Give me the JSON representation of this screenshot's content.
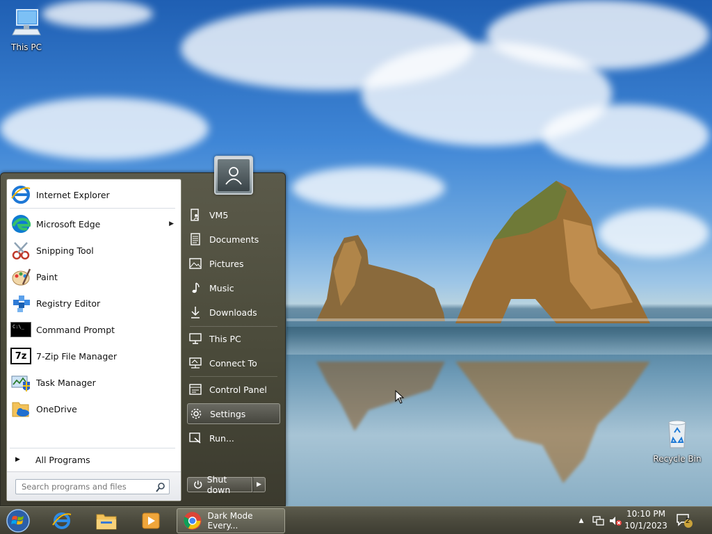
{
  "desktop": {
    "icons": [
      {
        "label": "This PC"
      },
      {
        "label": "Recycle Bin"
      }
    ]
  },
  "start_menu": {
    "programs": [
      {
        "label": "Internet Explorer",
        "icon": "internet-explorer-icon"
      },
      {
        "label": "Microsoft Edge",
        "icon": "edge-icon",
        "has_submenu": true
      },
      {
        "label": "Snipping Tool",
        "icon": "scissors-icon"
      },
      {
        "label": "Paint",
        "icon": "paint-palette-icon"
      },
      {
        "label": "Registry Editor",
        "icon": "registry-icon"
      },
      {
        "label": "Command Prompt",
        "icon": "cmd-icon"
      },
      {
        "label": "7-Zip File Manager",
        "icon": "7zip-icon"
      },
      {
        "label": "Task Manager",
        "icon": "task-manager-icon"
      },
      {
        "label": "OneDrive",
        "icon": "onedrive-icon"
      }
    ],
    "cmd_icon_text": "C:\\_",
    "sevenzip_icon_text": "7z",
    "all_programs_label": "All Programs",
    "search_placeholder": "Search programs and files",
    "places": [
      {
        "label": "VM5",
        "icon": "user-folder-icon"
      },
      {
        "label": "Documents",
        "icon": "document-icon"
      },
      {
        "label": "Pictures",
        "icon": "picture-icon"
      },
      {
        "label": "Music",
        "icon": "music-note-icon"
      },
      {
        "label": "Downloads",
        "icon": "download-arrow-icon"
      },
      {
        "label": "This PC",
        "icon": "computer-icon"
      },
      {
        "label": "Connect To",
        "icon": "connect-icon"
      },
      {
        "label": "Control Panel",
        "icon": "control-panel-icon"
      },
      {
        "label": "Settings",
        "icon": "gear-icon",
        "selected": true
      },
      {
        "label": "Run...",
        "icon": "run-icon"
      }
    ],
    "shutdown_label": "Shut down"
  },
  "taskbar": {
    "active_window_label": "Dark Mode Every...",
    "clock_time": "10:10 PM",
    "clock_date": "10/1/2023",
    "notification_count": "2"
  },
  "colors": {
    "taskbar": "#4b4a3d",
    "start_menu": "#4a4a3a",
    "selection": "#56554a"
  }
}
